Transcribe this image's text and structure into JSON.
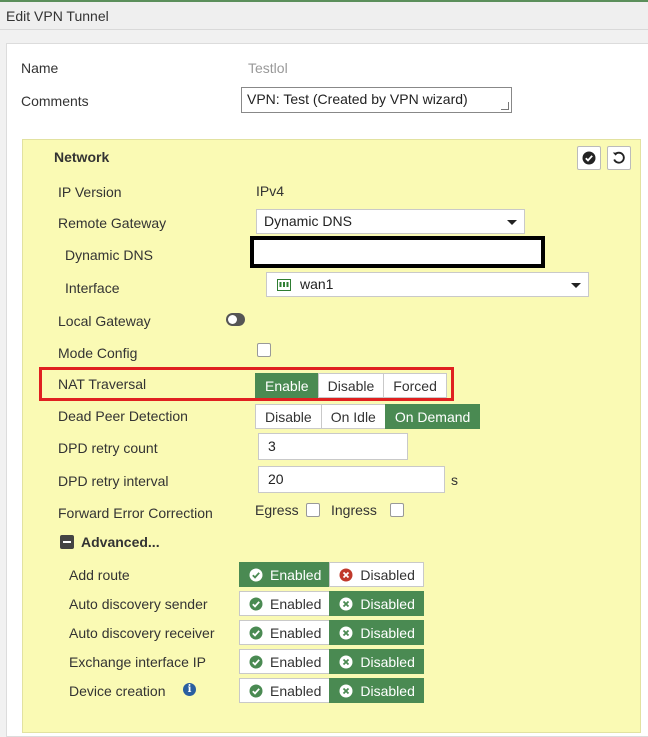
{
  "window": {
    "title": "Edit VPN Tunnel"
  },
  "form": {
    "name_label": "Name",
    "name_value": "Testlol",
    "comments_label": "Comments",
    "comments_value": "VPN: Test (Created by VPN wizard)"
  },
  "network": {
    "title": "Network",
    "ip_version_label": "IP Version",
    "ip_version_value": "IPv4",
    "remote_gateway_label": "Remote Gateway",
    "remote_gateway_value": "Dynamic DNS",
    "dynamic_dns_label": "Dynamic DNS",
    "dynamic_dns_value": "",
    "interface_label": "Interface",
    "interface_value": "wan1",
    "local_gateway_label": "Local Gateway",
    "mode_config_label": "Mode Config",
    "nat_traversal_label": "NAT Traversal",
    "nat_options": [
      "Enable",
      "Disable",
      "Forced"
    ],
    "nat_selected": "Enable",
    "dpd_label": "Dead Peer Detection",
    "dpd_options": [
      "Disable",
      "On Idle",
      "On Demand"
    ],
    "dpd_selected": "On Demand",
    "dpd_retry_count_label": "DPD retry count",
    "dpd_retry_count_value": "3",
    "dpd_retry_interval_label": "DPD retry interval",
    "dpd_retry_interval_value": "20",
    "dpd_retry_interval_unit": "s",
    "fec_label": "Forward Error Correction",
    "fec_egress": "Egress",
    "fec_ingress": "Ingress"
  },
  "advanced": {
    "title": "Advanced...",
    "enabled_label": "Enabled",
    "disabled_label": "Disabled",
    "rows": [
      {
        "label": "Add route",
        "state": "Enabled"
      },
      {
        "label": "Auto discovery sender",
        "state": "Disabled"
      },
      {
        "label": "Auto discovery receiver",
        "state": "Disabled"
      },
      {
        "label": "Exchange interface IP",
        "state": "Disabled"
      },
      {
        "label": "Device creation",
        "state": "Disabled"
      }
    ]
  },
  "colors": {
    "accent_green": "#4a8a52",
    "network_bg": "#fafab4",
    "highlight_red": "#e02020",
    "disabled_x_red": "#c0392b"
  }
}
